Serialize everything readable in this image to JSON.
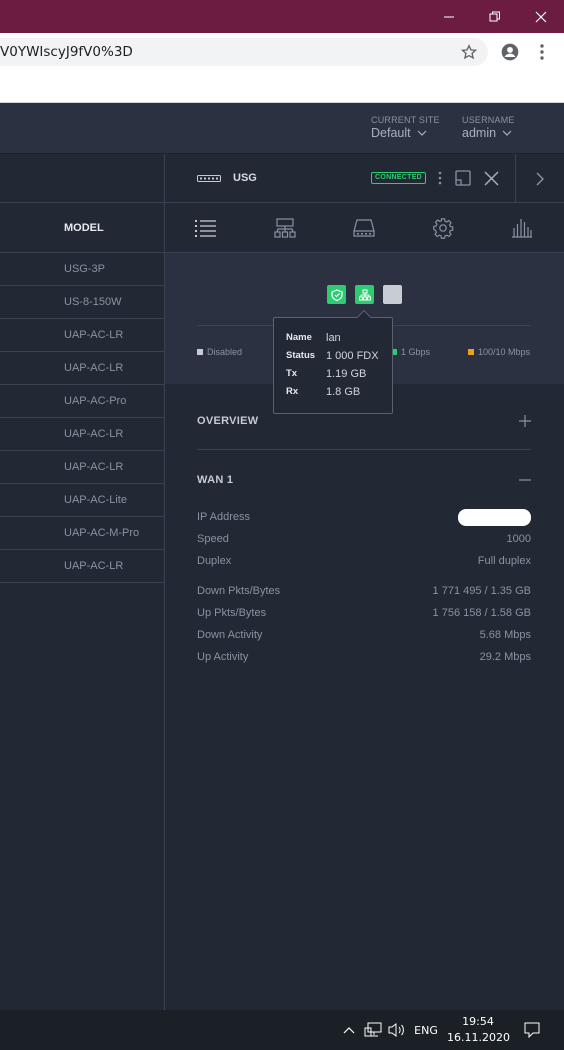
{
  "browser": {
    "url": "V0YWIscyJ9fV0%3D"
  },
  "header": {
    "site_label": "CURRENT SITE",
    "site_value": "Default",
    "user_label": "USERNAME",
    "user_value": "admin"
  },
  "table": {
    "model_header": "MODEL",
    "models": [
      "USG-3P",
      "US-8-150W",
      "UAP-AC-LR",
      "UAP-AC-LR",
      "UAP-AC-Pro",
      "UAP-AC-LR",
      "UAP-AC-LR",
      "UAP-AC-Lite",
      "UAP-AC-M-Pro",
      "UAP-AC-LR"
    ]
  },
  "device": {
    "name": "USG",
    "status": "CONNECTED"
  },
  "ports": {
    "legend": {
      "disabled": "Disabled",
      "gbps": "1 Gbps",
      "mbps": "100/10 Mbps"
    },
    "tooltip": {
      "name_key": "Name",
      "name_val": "lan",
      "status_key": "Status",
      "status_val": "1 000 FDX",
      "tx_key": "Tx",
      "tx_val": "1.19 GB",
      "rx_key": "Rx",
      "rx_val": "1.8 GB"
    }
  },
  "sections": {
    "overview": "OVERVIEW",
    "wan": "WAN 1"
  },
  "wan": {
    "ip_label": "IP Address",
    "speed_label": "Speed",
    "speed_val": "1000",
    "duplex_label": "Duplex",
    "duplex_val": "Full duplex",
    "down_pkts_label": "Down Pkts/Bytes",
    "down_pkts_val": "1 771 495 / 1.35 GB",
    "up_pkts_label": "Up Pkts/Bytes",
    "up_pkts_val": "1 756 158 / 1.58 GB",
    "down_act_label": "Down Activity",
    "down_act_val": "5.68 Mbps",
    "up_act_label": "Up Activity",
    "up_act_val": "29.2 Mbps"
  },
  "taskbar": {
    "lang": "ENG",
    "time": "19:54",
    "date": "16.11.2020"
  },
  "colors": {
    "port_green": "#2ecc71",
    "legend_orange": "#f0a020",
    "legend_green": "#2ecc71",
    "legend_grey": "#c8ccd4"
  }
}
